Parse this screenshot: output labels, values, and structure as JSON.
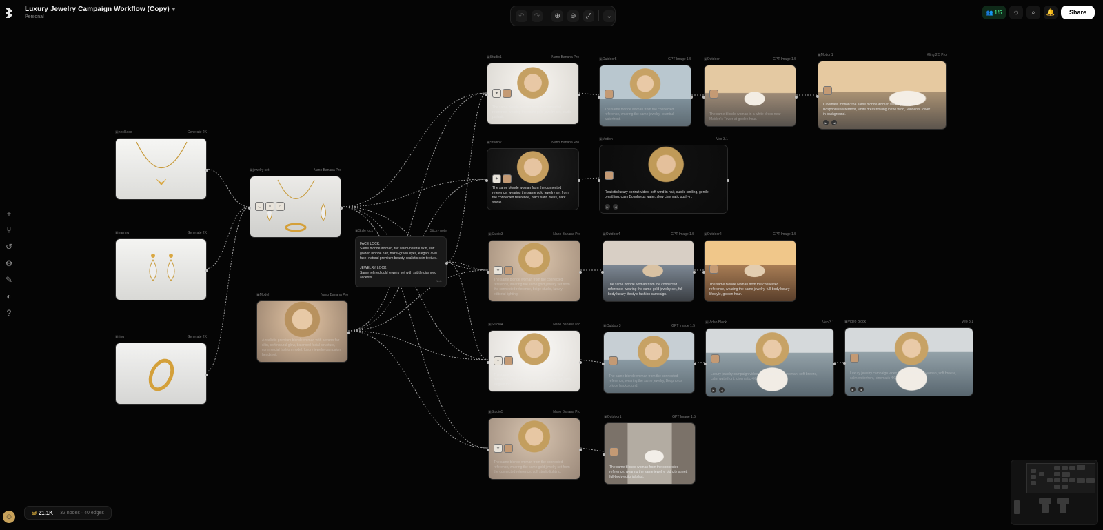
{
  "project": {
    "title": "Luxury Jewelry Campaign Workflow (Copy)",
    "workspace": "Personal"
  },
  "toolbar": {
    "undo": "↶",
    "redo": "↷",
    "zoom_in": "⊕",
    "zoom_out": "⊖",
    "fit": "⤢",
    "more": "⌄"
  },
  "header_right": {
    "collaborators": "1/5",
    "theme": "☼",
    "search": "⌕",
    "notifications": "🔔",
    "share": "Share"
  },
  "sidebar": {
    "add": "+",
    "branch": "⑂",
    "history": "↺",
    "settings": "⚙",
    "edit": "✎",
    "palette": "◐",
    "help": "?"
  },
  "footer": {
    "credits": "21.1K",
    "stats": "32 nodes · 40 edges"
  },
  "nodes": {
    "necklace": {
      "title": "necklace",
      "meta": "Generate 2K"
    },
    "earring": {
      "title": "earring",
      "meta": "Generate 2K"
    },
    "ring": {
      "title": "ring",
      "meta": "Generate 2K"
    },
    "jewelry_set": {
      "title": "jewelry set",
      "meta": "Nano Banana Pro"
    },
    "model": {
      "title": "Model",
      "meta": "Nano Banana Pro",
      "caption": "A realistic premium blonde woman with a warm fair skin, soft natural glow, balanced facial structure, commercial fashion model, luxury jewelry campaign headshot."
    },
    "style_lock": {
      "title": "Style lock",
      "meta": "Sticky note",
      "face_heading": "FACE LOCK:",
      "face_text": "Same blonde woman, fair warm-neutral skin, soft golden blonde hair, hazel-green eyes, elegant oval face, natural premium beauty, realistic skin texture.",
      "jewelry_heading": "JEWELRY LOCK:",
      "jewelry_text": "Same refined gold jewelry set with subtle diamond accents.",
      "foot": "Note"
    },
    "studio1": {
      "title": "Studio1",
      "meta": "Nano Banana Pro",
      "caption": "The same blonde woman from the connected reference, wearing the same gold jewelry set, studio portrait."
    },
    "outdoor5": {
      "title": "Outdoor5",
      "meta": "GPT Image 1.5",
      "caption": "The same blonde woman from the connected reference, wearing the same jewelry, Istanbul waterfront."
    },
    "outdoor": {
      "title": "Outdoor",
      "meta": "GPT Image 1.5",
      "caption": "The same blonde woman in a white dress near Maiden's Tower at golden hour."
    },
    "motion1": {
      "title": "Motion1",
      "meta": "Kling 2.5 Pro",
      "caption": "Cinematic motion: the same blonde woman walking along the Bosphorus waterfront, white dress flowing in the wind, Maiden's Tower in background."
    },
    "studio2": {
      "title": "Studio2",
      "meta": "Nano Banana Pro",
      "caption": "The same blonde woman from the connected reference, wearing the same gold jewelry set from the connected reference, black satin dress, dark studio."
    },
    "motion": {
      "title": "Motion",
      "meta": "Veo 3.1",
      "caption": "Realistic luxury portrait video, soft wind in hair, subtle smiling, gentle breathing, calm Bosphorus water, slow cinematic push-in."
    },
    "studio3": {
      "title": "Studio3",
      "meta": "Nano Banana Pro",
      "caption": "The same blonde woman from the connected reference, wearing the same gold jewelry set from the connected reference, beige studio, luxury editorial lighting."
    },
    "outdoor4": {
      "title": "Outdoor4",
      "meta": "GPT Image 1.5",
      "caption": "The same blonde woman from the connected reference, wearing the same gold jewelry set, full-body luxury lifestyle fashion campaign."
    },
    "outdoor2": {
      "title": "Outdoor2",
      "meta": "GPT Image 1.5",
      "caption": "The same blonde woman from the connected reference, wearing the same jewelry, full-body luxury lifestyle, golden hour."
    },
    "studio4": {
      "title": "Studio4",
      "meta": "Nano Banana Pro",
      "caption": "The same blonde woman from the connected reference, wearing the same gold jewelry set, white elegant top."
    },
    "outdoor3": {
      "title": "Outdoor3",
      "meta": "GPT Image 1.5",
      "caption": "The same blonde woman from the connected reference, wearing the same jewelry, Bosphorus bridge background."
    },
    "video_block1": {
      "title": "Video Block",
      "meta": "Veo 3.1",
      "caption": "Luxury jewelry campaign video, the same blonde woman, soft breeze, calm waterfront, cinematic 4K."
    },
    "video_block2": {
      "title": "Video Block",
      "meta": "Veo 3.1",
      "caption": "Luxury jewelry campaign video, the same blonde woman, soft breeze, calm waterfront, cinematic 4K."
    },
    "studio5": {
      "title": "Studio5",
      "meta": "Nano Banana Pro",
      "caption": "The same blonde woman from the connected reference, wearing the same gold jewelry set from the connected reference, soft studio lighting."
    },
    "outdoor1": {
      "title": "Outdoor1",
      "meta": "GPT Image 1.5",
      "caption": "The same blonde woman from the connected reference, wearing the same jewelry, old city street, full-body editorial shot."
    }
  }
}
